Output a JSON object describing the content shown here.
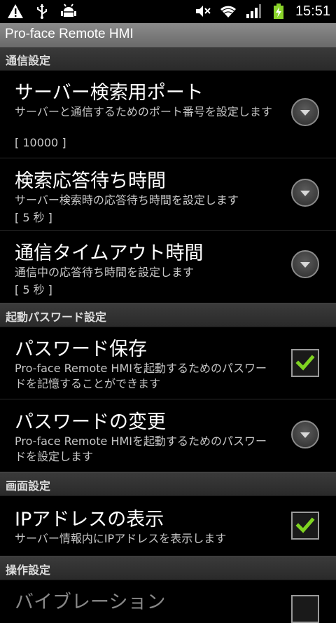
{
  "status_bar": {
    "time": "15:51",
    "left_icons": [
      "warning-icon",
      "usb-icon",
      "android-debug-icon"
    ],
    "right_icons": [
      "mute-icon",
      "wifi-icon",
      "signal-icon",
      "battery-charging-icon"
    ]
  },
  "app": {
    "title": "Pro-face Remote HMI"
  },
  "sections": [
    {
      "label": "通信設定"
    },
    {
      "label": "起動パスワード設定"
    },
    {
      "label": "画面設定"
    },
    {
      "label": "操作設定"
    }
  ],
  "items": [
    {
      "title": "サーバー検索用ポート",
      "summary": "サーバーと通信するためのポート番号を設定します",
      "value": "[ 10000 ]",
      "control": "dropdown"
    },
    {
      "title": "検索応答待ち時間",
      "summary": "サーバー検索時の応答待ち時間を設定します",
      "value": "[ 5 秒 ]",
      "control": "dropdown"
    },
    {
      "title": "通信タイムアウト時間",
      "summary": "通信中の応答待ち時間を設定します",
      "value": "[ 5 秒 ]",
      "control": "dropdown"
    },
    {
      "title": "パスワード保存",
      "summary": "Pro-face Remote HMIを起動するためのパスワードを記憶することができます",
      "control": "checkbox",
      "checked": true
    },
    {
      "title": "パスワードの変更",
      "summary": "Pro-face Remote HMIを起動するためのパスワードを設定します",
      "control": "dropdown"
    },
    {
      "title": "IPアドレスの表示",
      "summary": "サーバー情報内にIPアドレスを表示します",
      "control": "checkbox",
      "checked": true
    },
    {
      "title": "バイブレーション"
    }
  ],
  "colors": {
    "check": "#7fd321",
    "background": "#000000",
    "title_bar": "#7a7a7a"
  }
}
